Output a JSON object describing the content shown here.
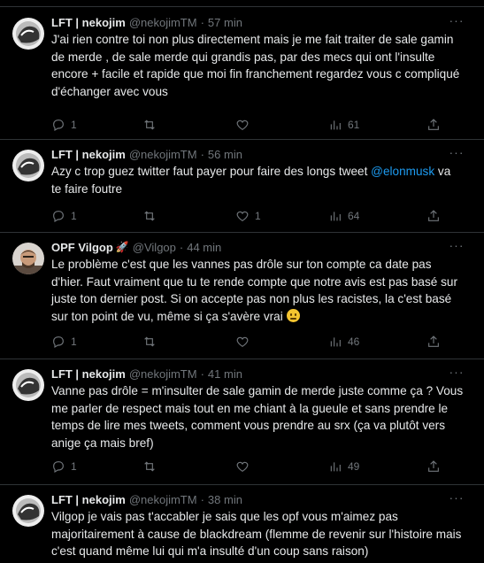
{
  "tweets": [
    {
      "name": "LFT | nekojim",
      "handle": "@nekojimTM",
      "time": "57 min",
      "body": "J'ai rien contre toi non plus directement mais je me fait traiter de sale gamin de merde , de sale merde qui grandis pas, par des mecs qui ont l'insulte encore + facile et rapide que  moi fin franchement regardez vous c compliqué d'échanger avec vous",
      "replies": "1",
      "retweets": "",
      "likes": "",
      "views": "61"
    },
    {
      "name": "LFT | nekojim",
      "handle": "@nekojimTM",
      "time": "56 min",
      "body_pre": "Azy c trop guez twitter faut payer pour faire des longs tweet ",
      "mention": "@elonmusk",
      "body_post": " va te faire foutre",
      "replies": "1",
      "retweets": "",
      "likes": "1",
      "views": "64"
    },
    {
      "name": "OPF Vilgop",
      "badge": "🚀",
      "handle": "@Vilgop",
      "time": "44 min",
      "body": "Le problème c'est que les vannes pas drôle sur ton compte ca date pas d'hier. Faut vraiment que tu te rende compte que notre avis est pas basé sur juste ton dernier post. Si on accepte pas non plus les racistes, la c'est basé sur ton point de vu, même si ça s'avère vrai",
      "emoji": "slightly-frowning-face",
      "replies": "1",
      "retweets": "",
      "likes": "",
      "views": "46"
    },
    {
      "name": "LFT | nekojim",
      "handle": "@nekojimTM",
      "time": "41 min",
      "body": "Vanne pas drôle = m'insulter de sale gamin de merde juste comme ça ? Vous me parler de respect mais tout en me chiant à la gueule et sans prendre le temps de lire mes tweets, comment vous prendre au srx  (ça va plutôt vers anige ça mais bref)",
      "replies": "1",
      "retweets": "",
      "likes": "",
      "views": "49"
    },
    {
      "name": "LFT | nekojim",
      "handle": "@nekojimTM",
      "time": "38 min",
      "body": "Vilgop je vais pas t'accabler je sais que les opf vous m'aimez pas majoritairement à cause de blackdream (flemme de revenir sur l'histoire mais c'est quand même lui qui m'a insulté d'un coup sans raison)"
    }
  ],
  "icons": {
    "reply": "reply-icon",
    "retweet": "retweet-icon",
    "like": "heart-icon",
    "views": "views-chart-icon",
    "share": "share-icon",
    "more": "more-options-icon"
  },
  "colors": {
    "background": "#000000",
    "text": "#e7e9ea",
    "muted": "#71767b",
    "border": "#2f3336",
    "link": "#1d9bf0"
  }
}
